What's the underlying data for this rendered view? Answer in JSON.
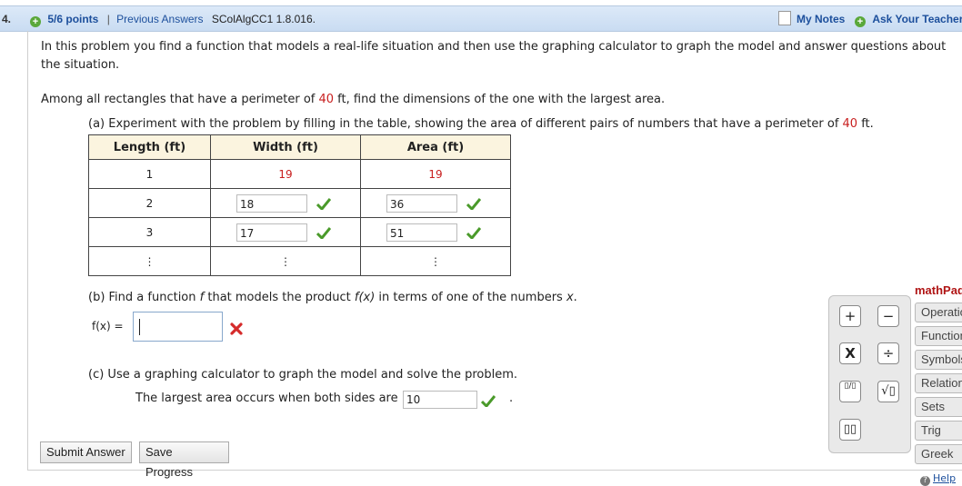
{
  "header": {
    "question_number": "4.",
    "points": "5/6 points",
    "separator": "|",
    "previous_answers": "Previous Answers",
    "problem_code": "SColAlgCC1 1.8.016.",
    "my_notes": "My Notes",
    "ask_teacher": "Ask Your Teacher"
  },
  "intro": "In this problem you find a function that models a real-life situation and then use the graphing calculator to graph the model and answer questions about the situation.",
  "problem": {
    "prefix": "Among all rectangles that have a perimeter of ",
    "perimeter": "40",
    "suffix": " ft, find the dimensions of the one with the largest area."
  },
  "part_a": {
    "prefix": "(a) Experiment with the problem by filling in the table, showing the area of different pairs of numbers that have a perimeter of ",
    "perimeter": "40",
    "suffix": " ft."
  },
  "table": {
    "headers": [
      "Length (ft)",
      "Width (ft)",
      "Area (ft)"
    ],
    "row1": {
      "length": "1",
      "width": "19",
      "area": "19"
    },
    "row2": {
      "length": "2",
      "width": "18",
      "area": "36"
    },
    "row3": {
      "length": "3",
      "width": "17",
      "area": "51"
    },
    "ellipsis": "⋮"
  },
  "part_b": {
    "text_before": "(b) Find a function ",
    "f": "f",
    "text_mid": " that models the product ",
    "fx": "f(x)",
    "text_mid2": " in terms of one of the numbers ",
    "x": "x",
    "text_end": ".",
    "label": "f(x) =",
    "value": ""
  },
  "part_c": {
    "text": "(c) Use a graphing calculator to graph the model and solve the problem.",
    "sentence": "The largest area occurs when both sides are",
    "value": "10",
    "end": "."
  },
  "buttons": {
    "submit": "Submit Answer",
    "save": "Save Progress"
  },
  "palette": {
    "title": "mathPad",
    "tabs": [
      "Operations",
      "Functions",
      "Symbols",
      "Relations",
      "Sets",
      "Trig",
      "Greek"
    ],
    "help": "Help",
    "keys": {
      "plus": "+",
      "minus": "−",
      "times": "X",
      "divide": "÷",
      "fraction": "▯/▯",
      "sqrt": "√▯",
      "power": "▯▯"
    }
  },
  "colors": {
    "accent_red": "#c81e1e",
    "link": "#1c4f9c",
    "check": "#4a9a2a",
    "cross": "#d52b2b"
  }
}
